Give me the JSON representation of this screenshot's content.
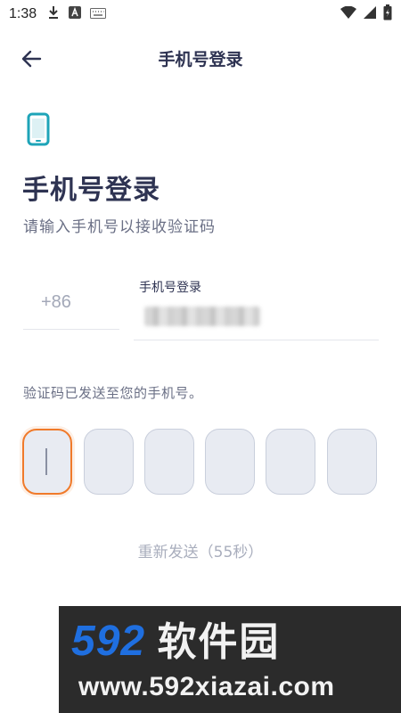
{
  "status_bar": {
    "time": "1:38",
    "icons": [
      "download-icon",
      "a-badge-icon",
      "keyboard-icon",
      "wifi-icon",
      "signal-icon",
      "battery-icon"
    ]
  },
  "header": {
    "title": "手机号登录",
    "back_icon": "arrow-left-icon"
  },
  "main": {
    "heading": "手机号登录",
    "subheading": "请输入手机号以接收验证码",
    "phone_icon": "smartphone-icon",
    "accent_color": "#1ea4b8",
    "country_code": "+86",
    "phone_label": "手机号登录",
    "phone_value": "",
    "sent_message": "验证码已发送至您的手机号。",
    "code_boxes": [
      "",
      "",
      "",
      "",
      "",
      ""
    ],
    "active_box": 0,
    "active_color": "#f07a2a",
    "resend_text": "重新发送（55秒）"
  },
  "watermark": {
    "logo_number": "592",
    "logo_text": "软件园",
    "url": "www.592xiazai.com"
  }
}
